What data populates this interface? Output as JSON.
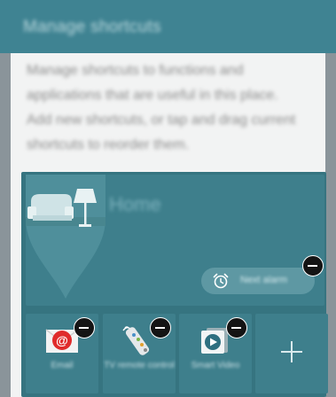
{
  "header": {
    "title": "Manage shortcuts"
  },
  "description": "Manage shortcuts to functions and applications that are useful in this place. Add new shortcuts, or tap and drag current shortcuts to reorder them.",
  "home": {
    "label": "Home",
    "alarm": {
      "label": "Next alarm",
      "icon": "alarm-clock-icon"
    }
  },
  "shortcuts": [
    {
      "label": "Email",
      "icon": "email-icon"
    },
    {
      "label": "TV remote control",
      "icon": "remote-control-icon"
    },
    {
      "label": "Smart Video",
      "icon": "video-icon"
    }
  ],
  "add_shortcut": {
    "icon": "plus-icon"
  },
  "colors": {
    "header": "#3f8392",
    "card": "#367480",
    "tile": "#3e7f8c"
  }
}
